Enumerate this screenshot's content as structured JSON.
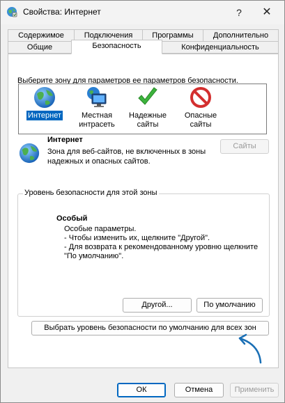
{
  "window": {
    "title": "Свойства: Интернет",
    "help_glyph": "?",
    "close_glyph": "✕"
  },
  "tabs_row1": [
    {
      "label": "Содержимое"
    },
    {
      "label": "Подключения"
    },
    {
      "label": "Программы"
    },
    {
      "label": "Дополнительно"
    }
  ],
  "tabs_row2": [
    {
      "label": "Общие"
    },
    {
      "label": "Безопасность",
      "active": true
    },
    {
      "label": "Конфиденциальность"
    }
  ],
  "zones": {
    "prompt": "Выберите зону для параметров ее параметров безопасности.",
    "items": [
      {
        "line1": "Интернет",
        "line2": "",
        "icon": "globe-icon",
        "selected": true
      },
      {
        "line1": "Местная",
        "line2": "интрасеть",
        "icon": "intranet-icon"
      },
      {
        "line1": "Надежные",
        "line2": "сайты",
        "icon": "checkmark-icon"
      },
      {
        "line1": "Опасные",
        "line2": "сайты",
        "icon": "prohibited-icon"
      }
    ]
  },
  "zone_info": {
    "title": "Интернет",
    "description": "Зона для веб-сайтов, не включенных в зоны надежных и опасных сайтов.",
    "sites_button": "Сайты"
  },
  "security_level": {
    "legend": "Уровень безопасности для этой зоны",
    "title": "Особый",
    "lines": [
      "Особые параметры.",
      "- Чтобы изменить их, щелкните \"Другой\".",
      "- Для возврата к рекомендованному уровню щелкните",
      "\"По умолчанию\"."
    ],
    "other_button": "Другой...",
    "default_button": "По умолчанию",
    "reset_all_button": "Выбрать уровень безопасности по умолчанию для всех зон"
  },
  "footer": {
    "ok": "ОК",
    "cancel": "Отмена",
    "apply": "Применить"
  },
  "colors": {
    "accent": "#0067c0",
    "annotation_arrow": "#1a6fb5"
  }
}
